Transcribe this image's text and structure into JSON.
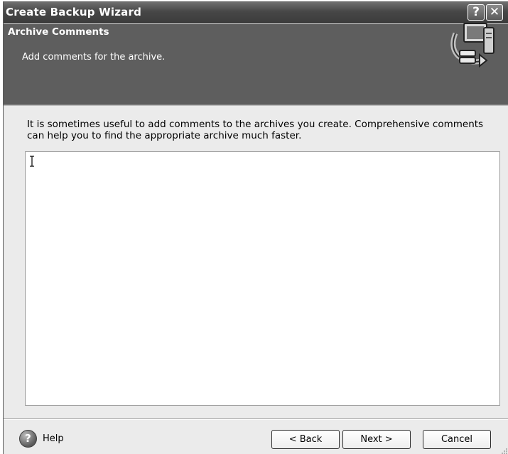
{
  "window": {
    "title": "Create Backup Wizard",
    "help_glyph": "?",
    "close_glyph": "✕"
  },
  "header": {
    "title": "Archive Comments",
    "subtitle": "Add comments for the archive.",
    "icon": "computer-backup-icon"
  },
  "description": "It is sometimes useful to add comments to the archives you create. Comprehensive comments can help you to find the appropriate archive much faster.",
  "comment_box": {
    "value": ""
  },
  "footer": {
    "help_label": "Help",
    "help_glyph": "?",
    "back_label": "< Back",
    "next_label": "Next >",
    "cancel_label": "Cancel"
  }
}
